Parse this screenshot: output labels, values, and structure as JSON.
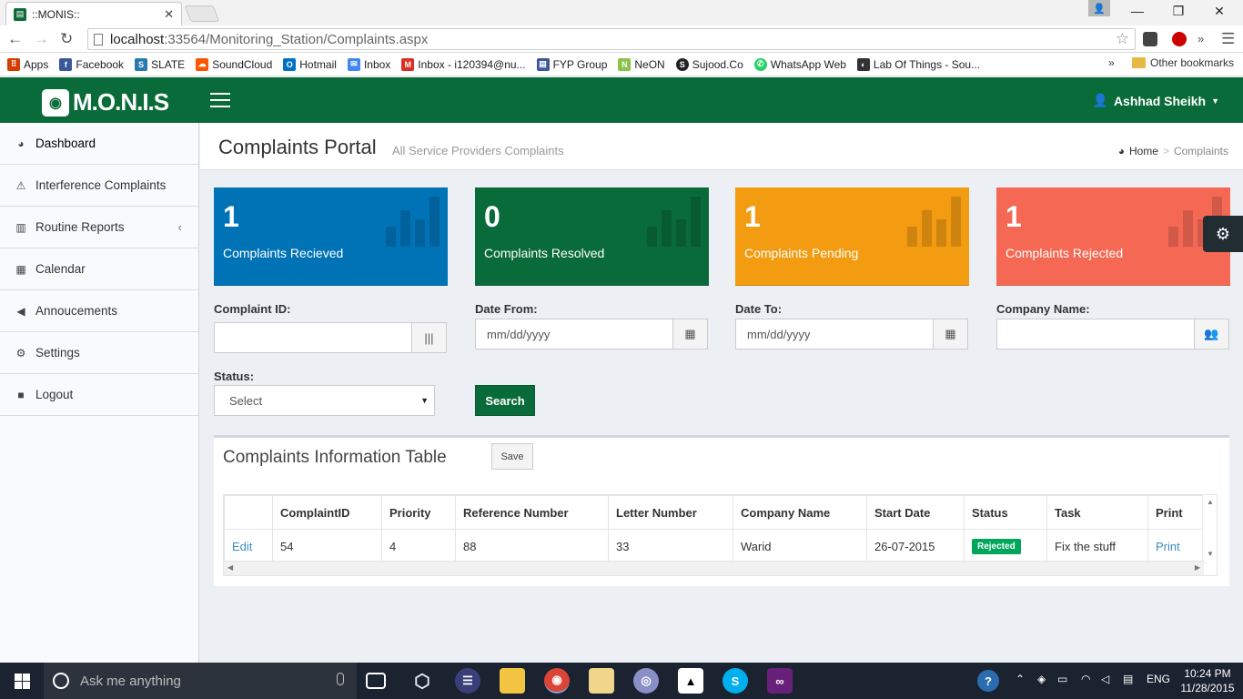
{
  "browser": {
    "tab_title": "::MONIS::",
    "url_host": "localhost",
    "url_path": ":33564/Monitoring_Station/Complaints.aspx",
    "bookmarks": [
      {
        "label": "Apps",
        "icon": "apps-icon",
        "color": "#d83b01"
      },
      {
        "label": "Facebook",
        "icon": "facebook-icon",
        "color": "#3b5998"
      },
      {
        "label": "SLATE",
        "icon": "slate-icon",
        "color": "#2a7ab0"
      },
      {
        "label": "SoundCloud",
        "icon": "soundcloud-icon",
        "color": "#ff5500"
      },
      {
        "label": "Hotmail",
        "icon": "hotmail-icon",
        "color": "#0072c6"
      },
      {
        "label": "Inbox",
        "icon": "inbox-icon",
        "color": "#4285f4"
      },
      {
        "label": "Inbox - i120394@nu...",
        "icon": "gmail-icon",
        "color": "#d93025"
      },
      {
        "label": "FYP Group",
        "icon": "fyp-group-icon",
        "color": "#3b5998"
      },
      {
        "label": "NeON",
        "icon": "neon-icon",
        "color": "#8bc34a"
      },
      {
        "label": "Sujood.Co",
        "icon": "sujood-icon",
        "color": "#222222"
      },
      {
        "label": "WhatsApp Web",
        "icon": "whatsapp-icon",
        "color": "#25d366"
      },
      {
        "label": "Lab Of Things - Sou...",
        "icon": "lab-of-things-icon",
        "color": "#333333"
      }
    ],
    "more": "»",
    "other_bookmarks": "Other bookmarks"
  },
  "header": {
    "logo_text": "M.O.N.I.S",
    "user_name": "Ashhad Sheikh"
  },
  "sidebar": {
    "items": [
      {
        "label": "Dashboard",
        "icon": "dashboard-icon",
        "glyph": "◕"
      },
      {
        "label": "Interference Complaints",
        "icon": "warning-icon",
        "glyph": "⚠"
      },
      {
        "label": "Routine Reports",
        "icon": "bar-chart-icon",
        "glyph": "▥"
      },
      {
        "label": "Calendar",
        "icon": "calendar-icon",
        "glyph": "▦"
      },
      {
        "label": "Annoucements",
        "icon": "bullhorn-icon",
        "glyph": "◀"
      },
      {
        "label": "Settings",
        "icon": "gear-icon",
        "glyph": "⚙"
      },
      {
        "label": "Logout",
        "icon": "lock-icon",
        "glyph": "🔒"
      }
    ]
  },
  "page": {
    "title": "Complaints Portal",
    "subtitle": "All Service Providers Complaints",
    "breadcrumb_home": "Home",
    "breadcrumb_sep": ">",
    "breadcrumb_current": "Complaints"
  },
  "stats": [
    {
      "value": "1",
      "label": "Complaints Recieved",
      "color": "#0073b7"
    },
    {
      "value": "0",
      "label": "Complaints Resolved",
      "color": "#0a6b3a"
    },
    {
      "value": "1",
      "label": "Complaints Pending",
      "color": "#f39c12"
    },
    {
      "value": "1",
      "label": "Complaints Rejected",
      "color": "#f56954"
    }
  ],
  "filters": {
    "complaint_id_label": "Complaint ID:",
    "complaint_id_value": "",
    "date_from_label": "Date From:",
    "date_from_placeholder": "mm/dd/yyyy",
    "date_to_label": "Date To:",
    "date_to_placeholder": "mm/dd/yyyy",
    "company_label": "Company Name:",
    "company_value": "",
    "status_label": "Status:",
    "status_selected": "Select",
    "search_button": "Search"
  },
  "table": {
    "title": "Complaints Information Table",
    "save_button": "Save",
    "columns": [
      "",
      "ComplaintID",
      "Priority",
      "Reference Number",
      "Letter Number",
      "Company Name",
      "Start Date",
      "Status",
      "Task",
      "Print"
    ],
    "rows": [
      {
        "edit": "Edit",
        "complaint_id": "54",
        "priority": "4",
        "reference_number": "88",
        "letter_number": "33",
        "company_name": "Warid",
        "start_date": "26-07-2015",
        "status": "Rejected",
        "task": "Fix the stuff",
        "print": "Print"
      }
    ]
  },
  "taskbar": {
    "search_placeholder": "Ask me anything",
    "language": "ENG",
    "time": "10:24 PM",
    "date": "11/28/2015"
  }
}
